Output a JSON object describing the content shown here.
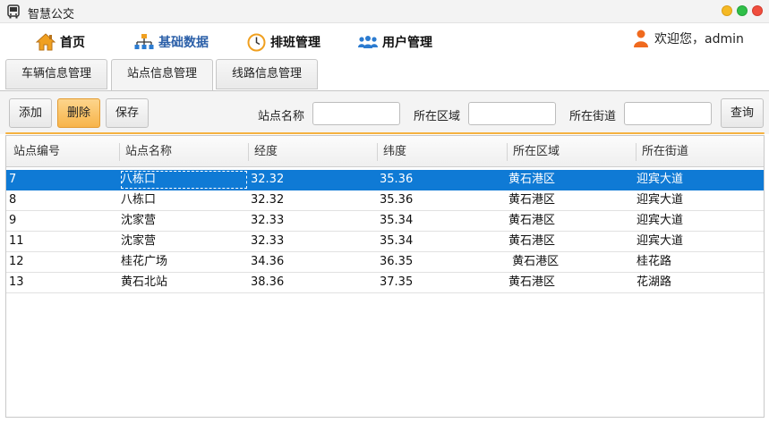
{
  "window": {
    "title": "智慧公交"
  },
  "nav": {
    "items": [
      {
        "label": "首页",
        "icon": "home-icon"
      },
      {
        "label": "基础数据",
        "icon": "hierarchy-icon",
        "active": true
      },
      {
        "label": "排班管理",
        "icon": "clock-icon"
      },
      {
        "label": "用户管理",
        "icon": "users-icon"
      }
    ],
    "welcome": "欢迎您，admin"
  },
  "tabs": [
    {
      "label": "车辆信息管理"
    },
    {
      "label": "站点信息管理",
      "selected": true
    },
    {
      "label": "线路信息管理"
    }
  ],
  "toolbar": {
    "add": "添加",
    "delete": "删除",
    "save": "保存",
    "station_name_label": "站点名称",
    "district_label": "所在区域",
    "street_label": "所在街道",
    "query": "查询",
    "station_name_value": "",
    "district_value": "",
    "street_value": ""
  },
  "table": {
    "columns": [
      "站点编号",
      "站点名称",
      "经度",
      "纬度",
      "所在区域",
      "所在街道"
    ],
    "rows": [
      [
        "7",
        "八栋口",
        "32.32",
        "35.36",
        "黄石港区",
        "迎宾大道"
      ],
      [
        "8",
        "八栋口",
        "32.32",
        "35.36",
        "黄石港区",
        "迎宾大道"
      ],
      [
        "9",
        "沈家营",
        "32.33",
        "35.34",
        "黄石港区",
        "迎宾大道"
      ],
      [
        "11",
        "沈家营",
        "32.33",
        "35.34",
        "黄石港区",
        "迎宾大道"
      ],
      [
        "12",
        "桂花广场",
        "34.36",
        "36.35",
        " 黄石港区",
        "桂花路"
      ],
      [
        "13",
        "黄石北站",
        "38.36",
        "37.35",
        "黄石港区",
        "花湖路"
      ]
    ],
    "selected_row": 0
  },
  "colors": {
    "accent_orange": "#f5b240",
    "selection_blue": "#0f7ad5",
    "nav_active": "#2b5fa8"
  }
}
